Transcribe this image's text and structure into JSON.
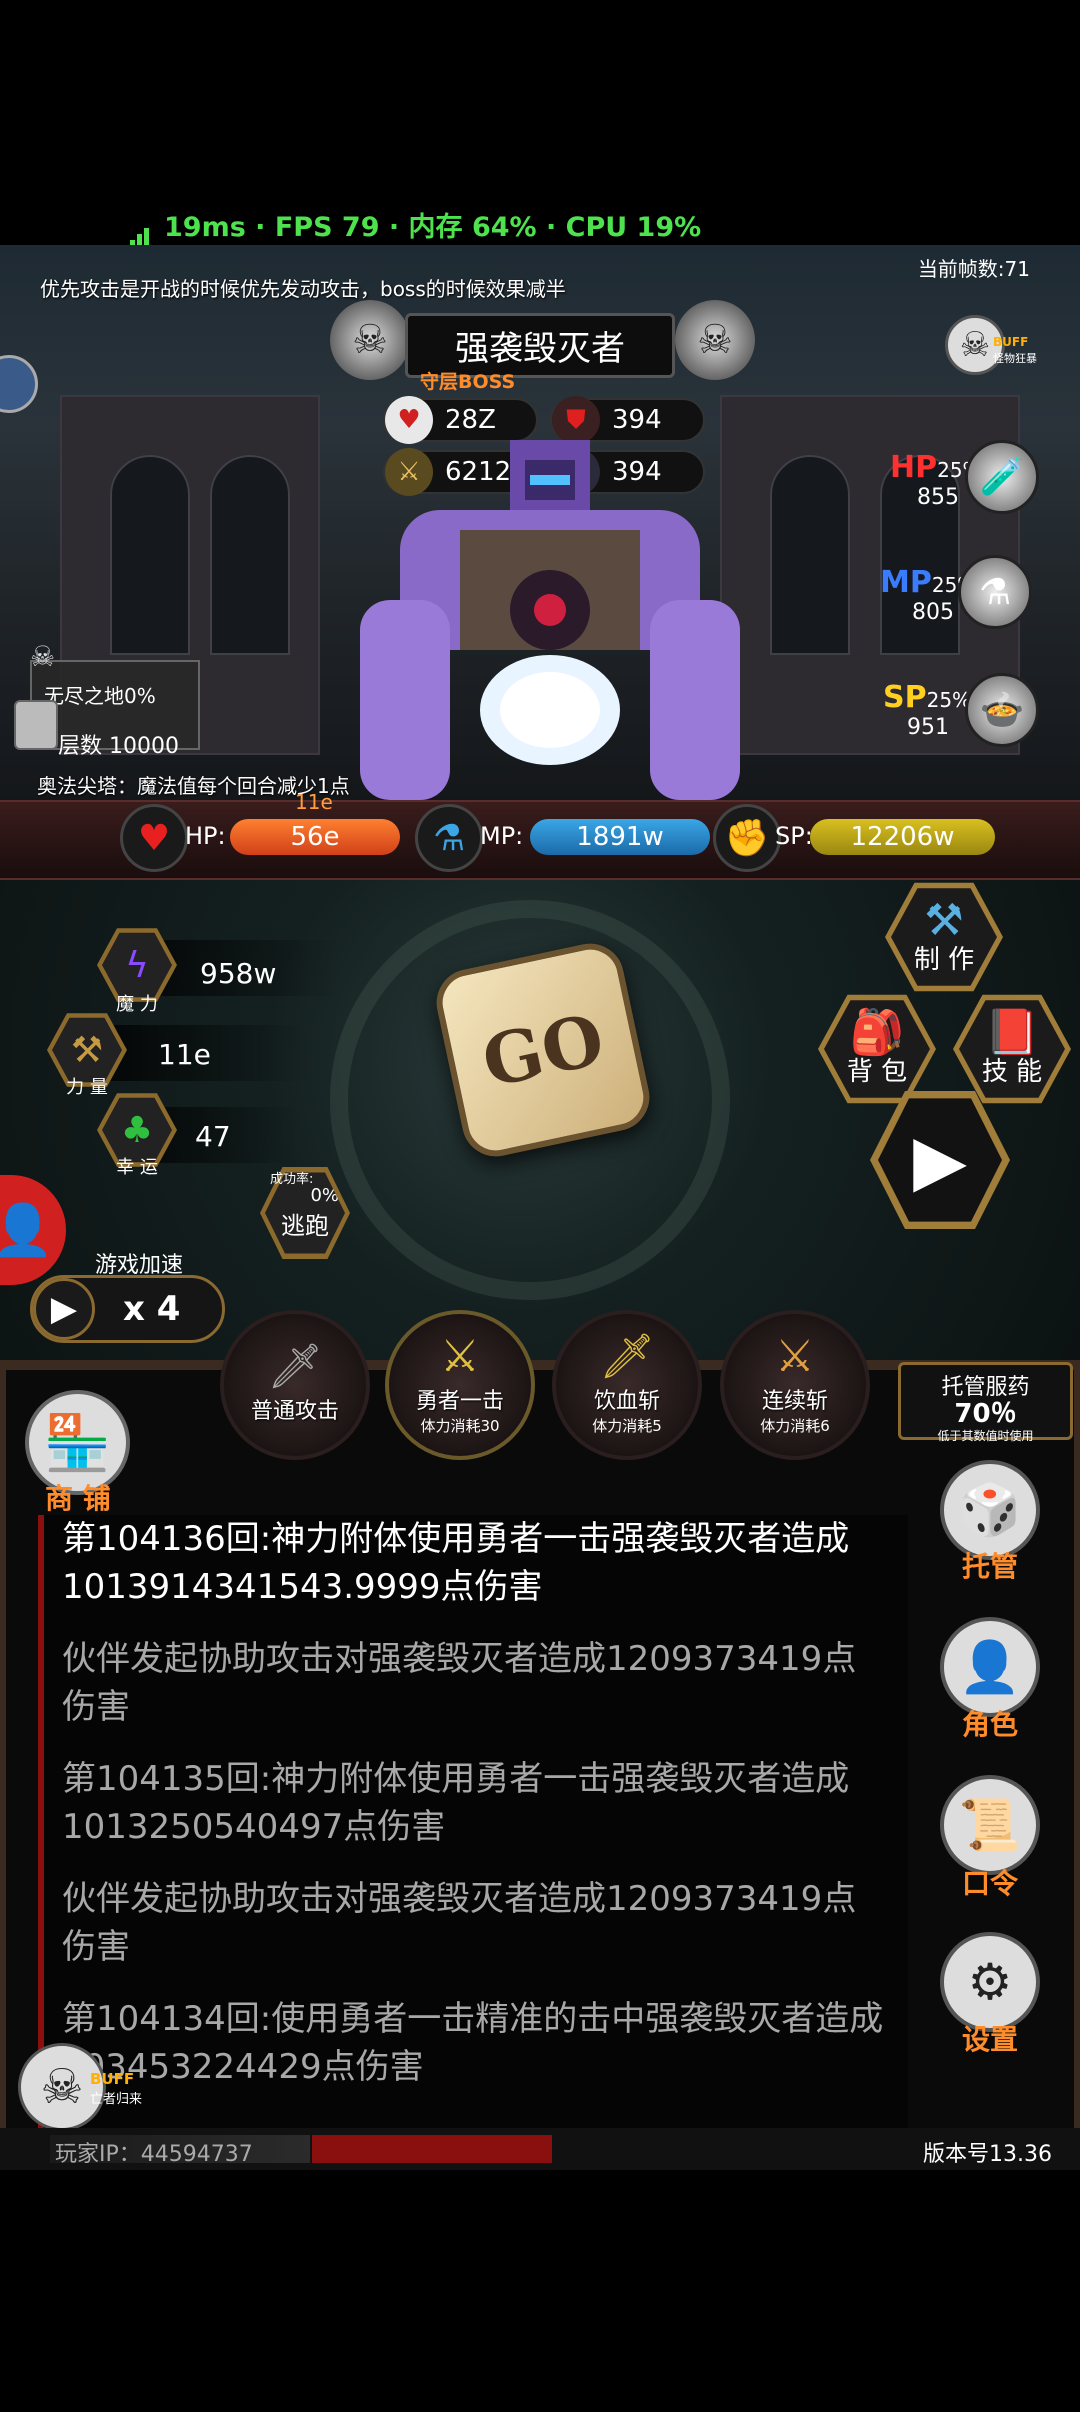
{
  "status": {
    "text": "19ms · FPS 79 · 内存 64% · CPU 19%"
  },
  "scene": {
    "tip": "优先攻击是开战的时候优先发动攻击，boss的时候效果减半",
    "frame_count": "当前帧数:71",
    "boss_name": "强袭毁灭者",
    "boss_tag": "守层BOSS",
    "boss_stats": {
      "hp": "28Z",
      "def": "394",
      "atk": "6212E",
      "mdef": "394"
    },
    "buff_top": "BUFF",
    "buff_top_sub": "怪物狂暴",
    "floor_name": "无尽之地0%",
    "floor_level": "层数 10000",
    "tower_text": "奥法尖塔：魔法值每个回合减少1点",
    "potions": [
      {
        "label": "HP",
        "pct": "25%",
        "value": "855",
        "color": "#ff3030",
        "icon": "hp-potion-icon"
      },
      {
        "label": "MP",
        "pct": "25%",
        "value": "805",
        "color": "#3a7cff",
        "icon": "mp-potion-icon"
      },
      {
        "label": "SP",
        "pct": "25%",
        "value": "951",
        "color": "#ffd020",
        "icon": "sp-food-icon"
      }
    ]
  },
  "player_bars": {
    "over_label": "11e",
    "hp_label": "HP:",
    "hp_value": "56e",
    "mp_label": "MP:",
    "mp_value": "1891w",
    "sp_label": "SP:",
    "sp_value": "12206w"
  },
  "attributes": [
    {
      "name": "魔 力",
      "value": "958w",
      "icon": "magic-bolt-icon"
    },
    {
      "name": "力 量",
      "value": "11e",
      "icon": "strength-icon"
    },
    {
      "name": "幸 运",
      "value": "47",
      "icon": "clover-icon"
    }
  ],
  "escape": {
    "success_label": "成功率:",
    "pct": "0%",
    "label": "逃跑"
  },
  "go_label": "GO",
  "actions": {
    "craft": "制 作",
    "bag": "背 包",
    "skills": "技 能"
  },
  "speed": {
    "label": "游戏加速",
    "value": "x 4"
  },
  "skills": [
    {
      "name": "普通攻击",
      "cost": ""
    },
    {
      "name": "勇者一击",
      "cost": "体力消耗30"
    },
    {
      "name": "饮血斩",
      "cost": "体力消耗5"
    },
    {
      "name": "连续斩",
      "cost": "体力消耗6"
    }
  ],
  "auto_potion": {
    "title": "托管服药",
    "pct": "70％",
    "note": "低于其数值时使用"
  },
  "shop_label": "商 铺",
  "log": [
    {
      "text": "第104136回:神力附体使用勇者一击强袭毁灭者造成1013914341543.9999点伤害",
      "kind": "current"
    },
    {
      "text": "伙伴发起协助攻击对强袭毁灭者造成1209373419点伤害",
      "kind": "past"
    },
    {
      "text": "第104135回:神力附体使用勇者一击强袭毁灭者造成1013250540497点伤害",
      "kind": "past"
    },
    {
      "text": "伙伴发起协助攻击对强袭毁灭者造成1209373419点伤害",
      "kind": "past"
    },
    {
      "text": "第104134回:使用勇者一击精准的击中强袭毁灭者造成903453224429点伤害",
      "kind": "past"
    }
  ],
  "menu": {
    "auto": "托管",
    "role": "角色",
    "code": "口令",
    "settings": "设置"
  },
  "buff_bottom": {
    "label": "BUFF",
    "sub": "亡者归来"
  },
  "footer": {
    "player_ip": "玩家IP：44594737",
    "version": "版本号13.36"
  },
  "colors": {
    "accent_orange": "#ff8c2a",
    "status_green": "#4ee24e",
    "log_border_red": "#8a1010"
  }
}
